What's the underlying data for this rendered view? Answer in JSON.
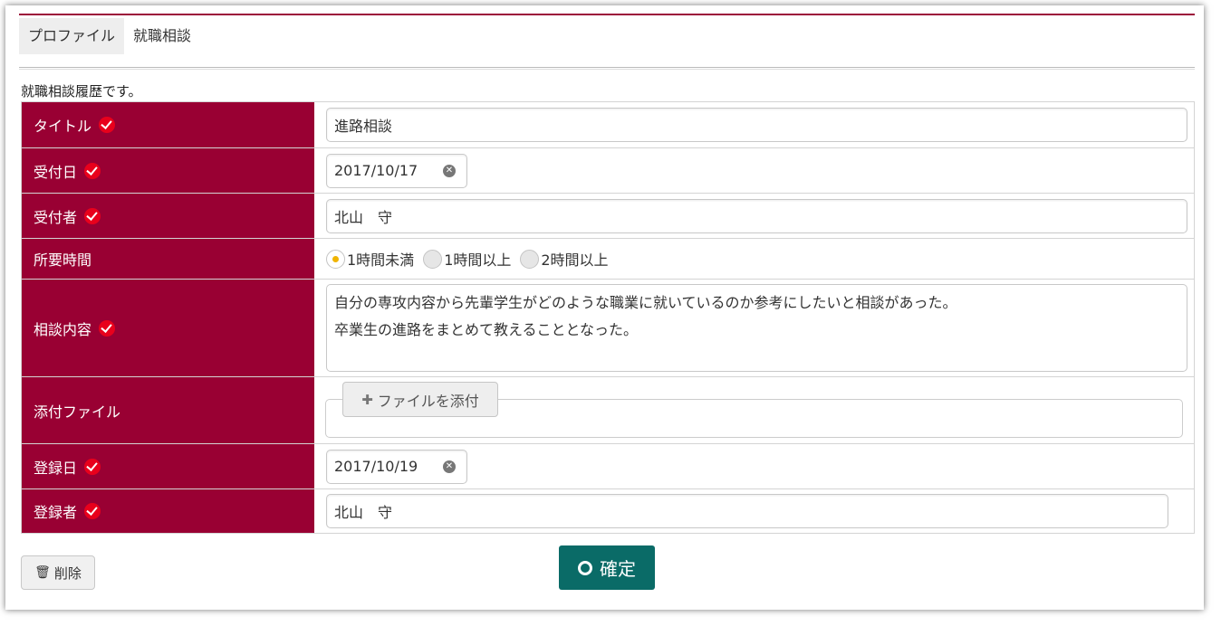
{
  "tabs": [
    {
      "label": "プロファイル",
      "active": true
    },
    {
      "label": "就職相談",
      "active": false
    }
  ],
  "description": "就職相談履歴です。",
  "fields": {
    "title": {
      "label": "タイトル",
      "value": "進路相談"
    },
    "reception_date": {
      "label": "受付日",
      "value": "2017/10/17"
    },
    "receptionist": {
      "label": "受付者",
      "value": "北山　守"
    },
    "duration": {
      "label": "所要時間",
      "options": [
        "1時間未満",
        "1時間以上",
        "2時間以上"
      ],
      "selected": "1時間未満"
    },
    "content": {
      "label": "相談内容",
      "lines": [
        "自分の専攻内容から先輩学生がどのような職業に就いているのか参考にしたいと相談があった。",
        "卒業生の進路をまとめて教えることとなった。"
      ]
    },
    "attachment": {
      "label": "添付ファイル",
      "button_label": "ファイルを添付"
    },
    "registration_date": {
      "label": "登録日",
      "value": "2017/10/19"
    },
    "registrant": {
      "label": "登録者",
      "value": "北山　守"
    }
  },
  "buttons": {
    "delete": "削除",
    "confirm": "確定"
  },
  "colors": {
    "label_bg": "#990033",
    "required_check": "#e8001c",
    "confirm_bg": "#0a6b67",
    "radio_selected": "#f0b400"
  },
  "icons": {
    "required": "check-circle-icon",
    "clear": "clear-icon",
    "add": "plus-icon",
    "delete": "trash-icon",
    "confirm": "ring-icon"
  }
}
